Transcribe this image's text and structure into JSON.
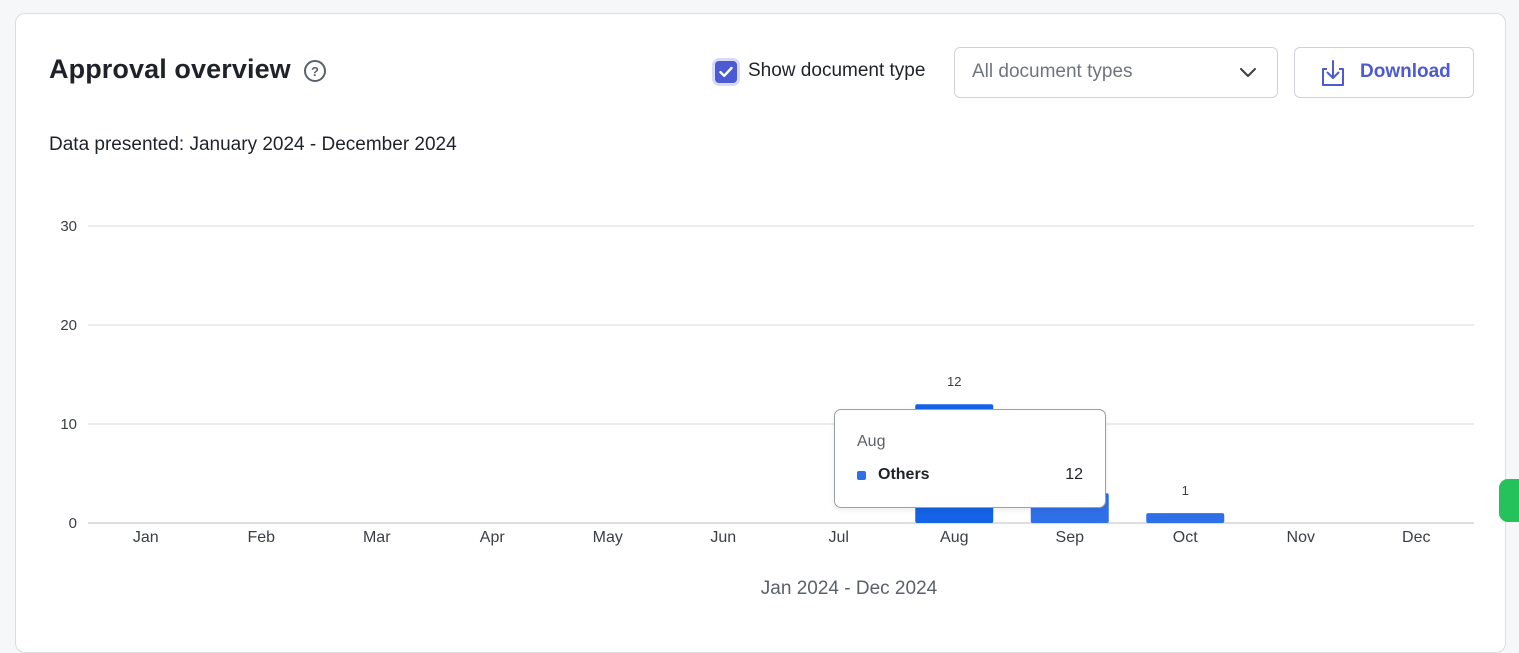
{
  "header": {
    "title": "Approval overview",
    "help_glyph": "?",
    "show_doc_type_label": "Show document type",
    "show_doc_type_checked": true,
    "doc_type_select_value": "All document types",
    "download_label": "Download"
  },
  "data_presented": "Data presented: January 2024 - December 2024",
  "icons": {
    "help": "question-circle-icon",
    "checkbox": "check-icon",
    "select": "chevron-down-icon",
    "download": "download-tray-icon",
    "chat": "whatsapp-icon"
  },
  "colors": {
    "accent": "#4c5bd4",
    "bar": "#2f6fe8",
    "bar_active": "#1463e6",
    "grid": "#d5d8dd"
  },
  "chart_data": {
    "type": "bar",
    "categories": [
      "Jan",
      "Feb",
      "Mar",
      "Apr",
      "May",
      "Jun",
      "Jul",
      "Aug",
      "Sep",
      "Oct",
      "Nov",
      "Dec"
    ],
    "series": [
      {
        "name": "Others",
        "values": [
          0,
          0,
          0,
          0,
          0,
          0,
          0,
          12,
          3,
          1,
          0,
          0
        ]
      }
    ],
    "data_labels": {
      "Aug": "12",
      "Oct": "1"
    },
    "ylim": [
      0,
      30
    ],
    "yticks": [
      0,
      10,
      20,
      30
    ],
    "xlabel": "Jan 2024 - Dec 2024",
    "ylabel": "",
    "grid": true,
    "legend": "none"
  },
  "tooltip": {
    "title": "Aug",
    "series_name": "Others",
    "value": "12"
  }
}
